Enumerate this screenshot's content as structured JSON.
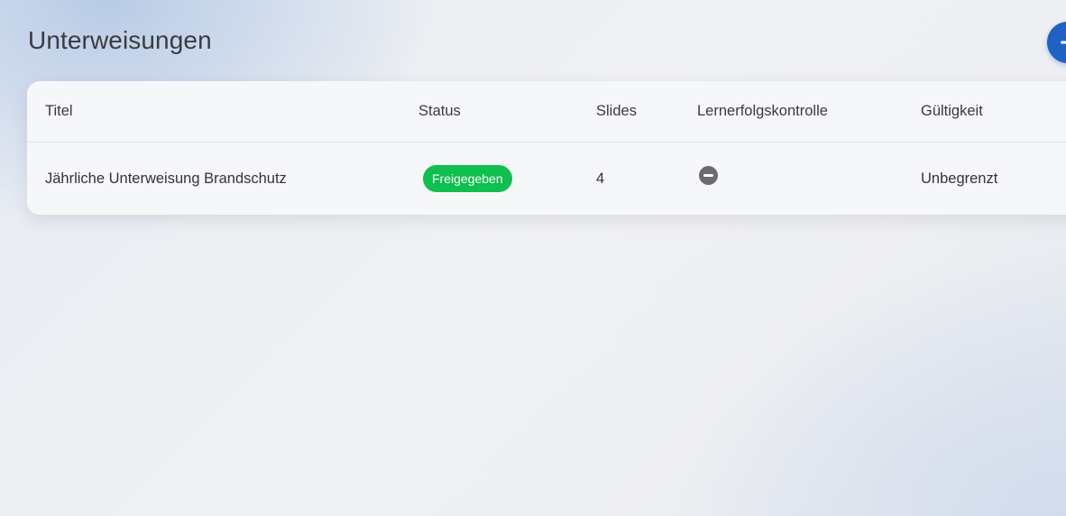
{
  "page": {
    "title": "Unterweisungen"
  },
  "actions": {
    "add_icon": "plus-icon",
    "add_color": "#1e63c4"
  },
  "table": {
    "columns": [
      {
        "label": "Titel"
      },
      {
        "label": "Status"
      },
      {
        "label": "Slides"
      },
      {
        "label": "Lernerfolgskontrolle"
      },
      {
        "label": "Gültigkeit"
      }
    ],
    "rows": [
      {
        "title": "Jährliche Unterweisung Brandschutz",
        "status": "Freigegeben",
        "status_color": "#0fbf4f",
        "slides": "4",
        "quiz_icon": "minus-circle-icon",
        "validity": "Unbegrenzt"
      }
    ]
  }
}
